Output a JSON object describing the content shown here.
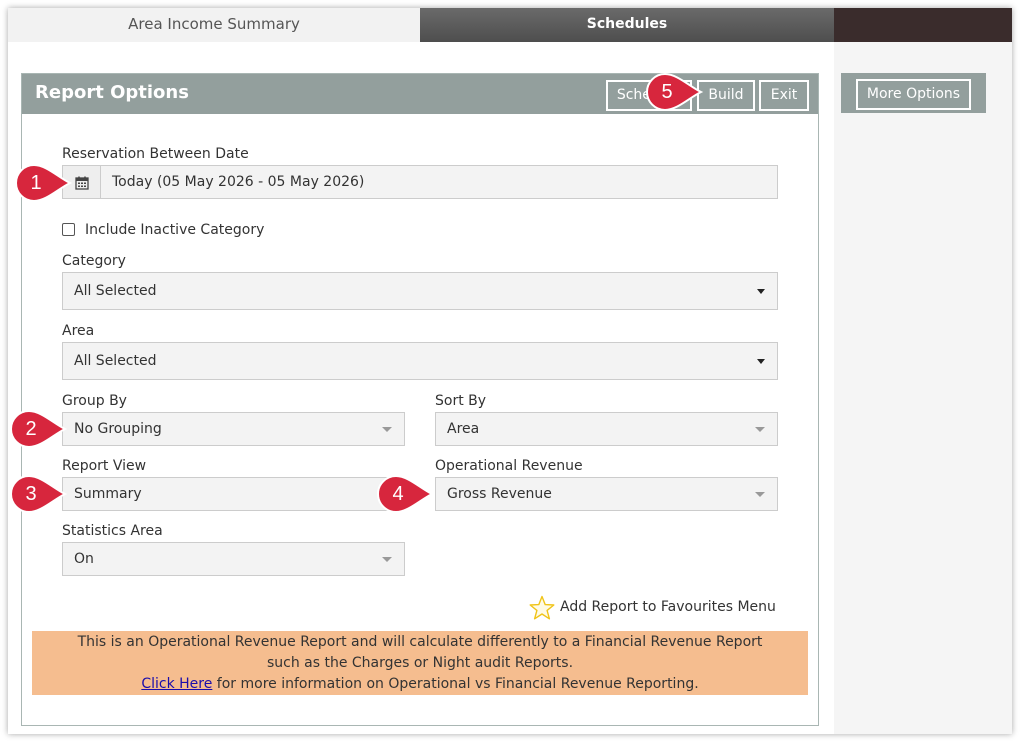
{
  "tabs": {
    "active": "Area Income Summary",
    "inactive": "Schedules"
  },
  "panel": {
    "title": "Report Options",
    "buttons": {
      "schedule": "Schedule",
      "build": "Build",
      "exit": "Exit"
    }
  },
  "more_options": "More Options",
  "date": {
    "label": "Reservation Between Date",
    "value": "Today (05 May 2026 - 05 May 2026)",
    "icon": "calendar-icon"
  },
  "include_inactive": {
    "label": "Include Inactive Category",
    "checked": false
  },
  "category": {
    "label": "Category",
    "value": "All Selected"
  },
  "area": {
    "label": "Area",
    "value": "All Selected"
  },
  "group_by": {
    "label": "Group By",
    "value": "No Grouping"
  },
  "sort_by": {
    "label": "Sort By",
    "value": "Area"
  },
  "report_view": {
    "label": "Report View",
    "value": "Summary"
  },
  "operational_revenue": {
    "label": "Operational Revenue",
    "value": "Gross Revenue"
  },
  "statistics_area": {
    "label": "Statistics Area",
    "value": "On"
  },
  "favourites": {
    "label": "Add Report to Favourites Menu",
    "icon": "star-outline-icon"
  },
  "notice": {
    "line1": "This is an Operational Revenue Report and will calculate differently to a Financial Revenue Report",
    "line2": "such as the Charges or Night audit Reports.",
    "link": "Click Here",
    "line3_rest": " for more information on Operational vs Financial Revenue Reporting."
  },
  "callouts": [
    "1",
    "2",
    "3",
    "4",
    "5"
  ],
  "colors": {
    "header": "#939f9d",
    "notice_bg": "#f5bd8f",
    "callout": "#d7263d",
    "tab_dark": "#4e4e4e"
  }
}
